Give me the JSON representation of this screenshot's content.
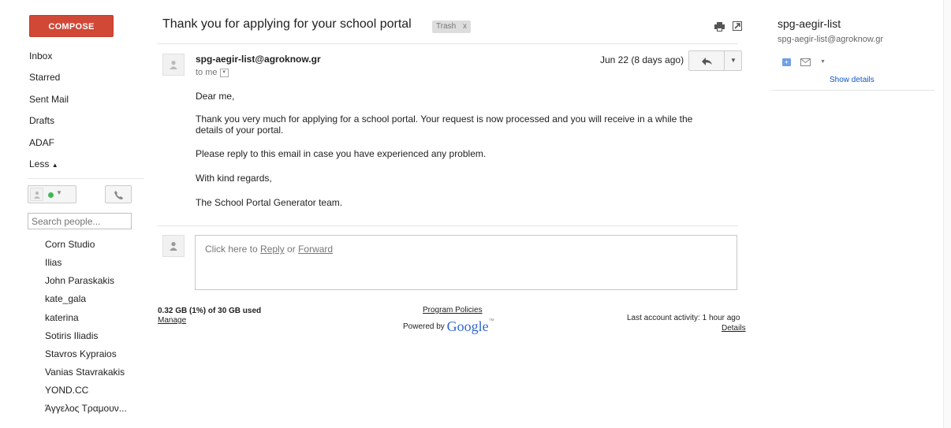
{
  "nav": {
    "compose": "COMPOSE",
    "items": [
      "Inbox",
      "Starred",
      "Sent Mail",
      "Drafts",
      "ADAF"
    ],
    "less": "Less"
  },
  "chat": {
    "search_placeholder": "Search people...",
    "contacts": [
      "Corn Studio",
      "Ilias",
      "John Paraskakis",
      "kate_gala",
      "katerina",
      "Sotiris Iliadis",
      "Stavros Kypraios",
      "Vanias Stavrakakis",
      "YOND.CC",
      "Άγγελος Τραμουν..."
    ]
  },
  "message": {
    "subject": "Thank you for applying for your school portal",
    "label": "Trash",
    "label_close": "x",
    "sender": "spg-aegir-list@agroknow.gr",
    "to": "to me",
    "date": "Jun 22 (8 days ago)",
    "body": [
      "Dear me,",
      "Thank you very much for applying for a school portal. Your request is now processed and you will receive in a while the",
      "details of your portal.",
      "Please reply to this email in case you have experienced any problem.",
      "With kind regards,",
      "The School Portal Generator team."
    ]
  },
  "reply": {
    "prefix": "Click here to ",
    "reply": "Reply",
    "or": " or ",
    "forward": "Forward"
  },
  "footer": {
    "storage": "0.32 GB (1%) of 30 GB used",
    "manage": "Manage",
    "policies": "Program Policies",
    "powered_by": "Powered by",
    "google": "Google",
    "tm": "™",
    "last_activity": "Last account activity: 1 hour ago",
    "details": "Details"
  },
  "contact_panel": {
    "name": "spg-aegir-list",
    "email": "spg-aegir-list@agroknow.gr",
    "show_details": "Show details"
  },
  "colors": {
    "compose": "#d14836",
    "link": "#1155cc",
    "presence": "#3cba54"
  }
}
